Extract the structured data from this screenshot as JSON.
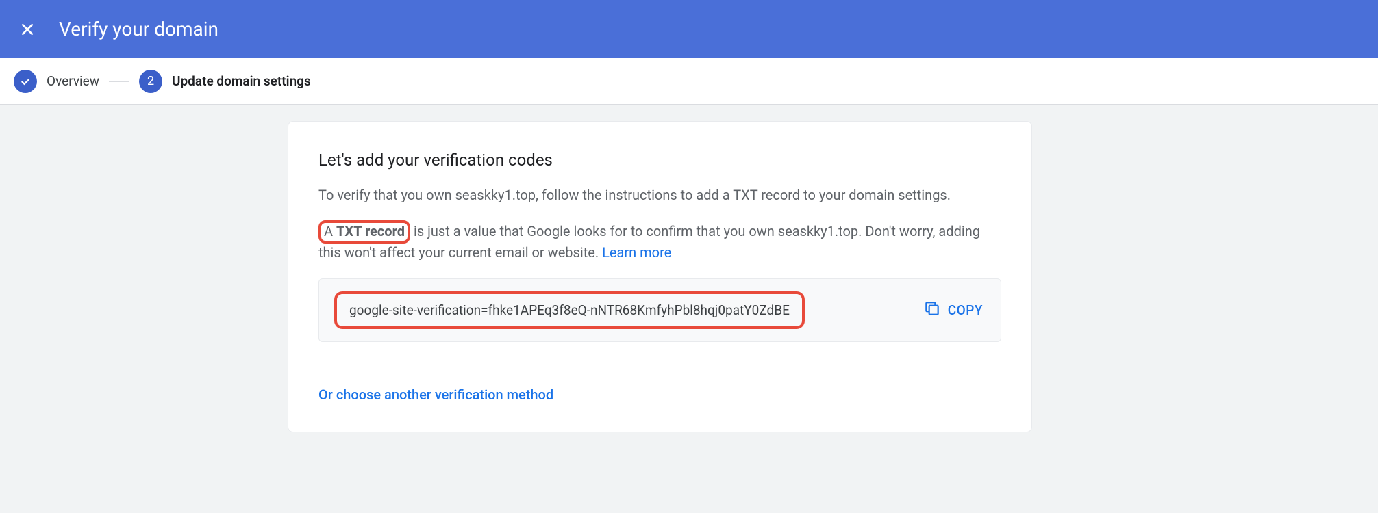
{
  "header": {
    "title": "Verify your domain"
  },
  "stepper": {
    "step1": {
      "label": "Overview"
    },
    "step2": {
      "number": "2",
      "label": "Update domain settings"
    }
  },
  "main": {
    "section_title": "Let's add your verification codes",
    "intro_text": "To verify that you own seaskky1.top, follow the instructions to add a TXT record to your domain settings.",
    "txt_prefix": "A ",
    "txt_bold": "TXT record",
    "txt_suffix": " is just a value that Google looks for to confirm that you own seaskky1.top. Don't worry, adding this won't affect your current email or website. ",
    "learn_more": "Learn more",
    "verification_code": "google-site-verification=fhke1APEq3f8eQ-nNTR68KmfyhPbl8hqj0patY0ZdBE",
    "copy_label": "COPY",
    "alt_method_label": "Or choose another verification method"
  }
}
